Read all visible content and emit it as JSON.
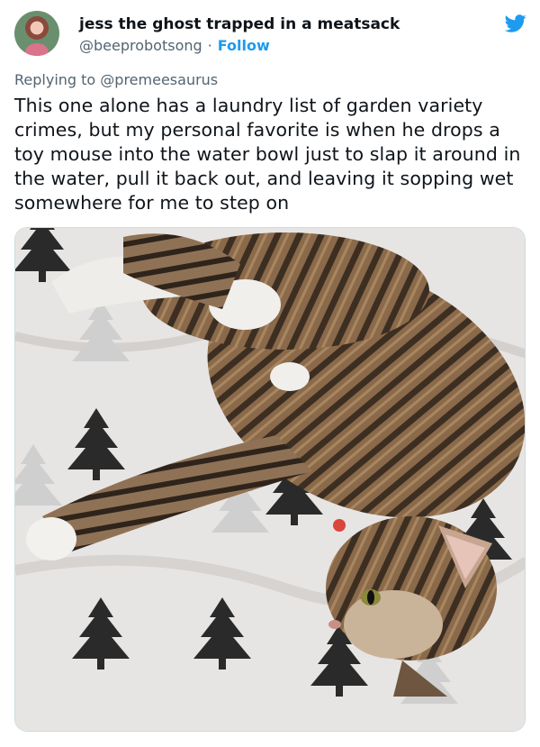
{
  "tweet": {
    "author_name": "jess the ghost trapped in a meatsack",
    "author_handle": "@beeprobotsong",
    "separator": "·",
    "follow_label": "Follow",
    "replying_prefix": "Replying to",
    "replying_to": "@premeesaurus",
    "text": "This one alone has a laundry list of garden variety crimes, but my personal favorite is when he drops a toy mouse into the water bowl just to slap it around in the water, pull it back out, and leaving it sopping wet somewhere for me to step on"
  },
  "icons": {
    "brand": "twitter-bird-icon",
    "brand_color": "#1d9bf0"
  },
  "colors": {
    "link": "#1d9bf0",
    "muted": "#536471",
    "text": "#0f1419"
  }
}
